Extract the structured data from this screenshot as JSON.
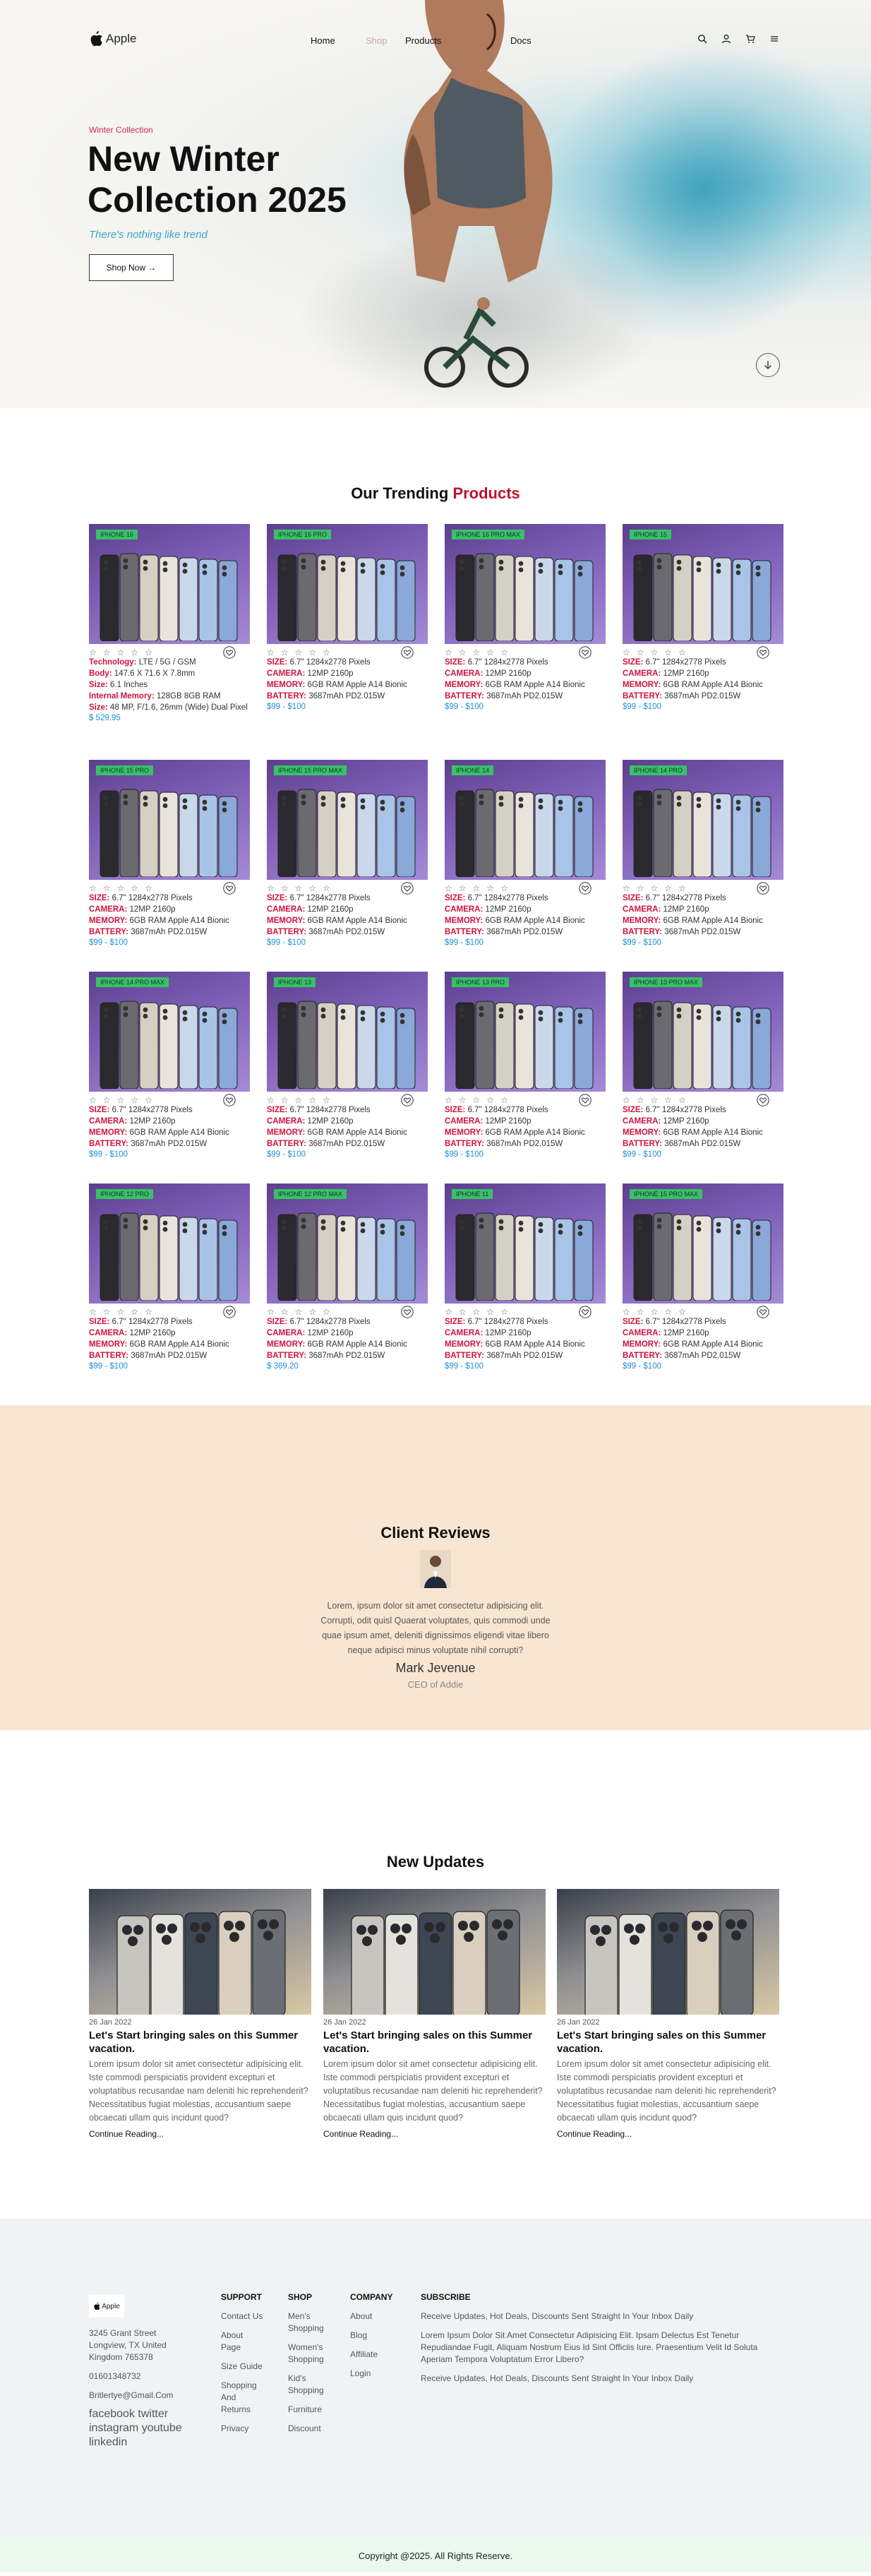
{
  "nav": {
    "brand": "Apple",
    "links": [
      "Home",
      "Shop",
      "Products",
      "Docs"
    ]
  },
  "hero": {
    "subtitle": "Winter Collection",
    "title_line1": "New Winter",
    "title_line2": "Collection 2025",
    "tagline": "There's nothing like trend",
    "button": "Shop Now →"
  },
  "trending": {
    "title_plain": "Our Trending",
    "title_accent": "Products",
    "spec_labels": {
      "size": "SIZE:",
      "camera": "CAMERA:",
      "memory": "MEMORY:",
      "battery": "BATTERY:"
    },
    "spec_values": {
      "size": "6.7\" 1284x2778 Pixels",
      "camera": "12MP 2160p",
      "memory": "6GB RAM Apple A14 Bionic",
      "battery": "3687mAh PD2.015W"
    },
    "first_card": {
      "technology_label": "Technology:",
      "technology": "LTE / 5G / GSM",
      "body_label": "Body:",
      "body": "147.6 X 71.6 X 7.8mm",
      "size_label": "Size:",
      "size": "6.1 Inches",
      "memory_label": "Internal Memory:",
      "memory": "128GB 8GB RAM",
      "camsize_label": "Size:",
      "camsize": "48 MP, F/1.6, 26mm (Wide) Dual Pixel",
      "price": "$ 529.95"
    },
    "cards": [
      {
        "badge": "IPHONE 16",
        "price": "$ 529.95"
      },
      {
        "badge": "IPHONE 16 PRO",
        "price": "$99 - $100"
      },
      {
        "badge": "IPHONE 16 PRO MAX",
        "price": "$99 - $100"
      },
      {
        "badge": "IPHONE 15",
        "price": "$99 - $100"
      },
      {
        "badge": "IPHONE 15 PRO",
        "price": "$99 - $100"
      },
      {
        "badge": "IPHONE 15 PRO MAX",
        "price": "$99 - $100"
      },
      {
        "badge": "IPHONE 14",
        "price": "$99 - $100"
      },
      {
        "badge": "IPHONE 14 PRO",
        "price": "$99 - $100"
      },
      {
        "badge": "IPHONE 14 PRO MAX",
        "price": "$99 - $100"
      },
      {
        "badge": "IPHONE 13",
        "price": "$99 - $100"
      },
      {
        "badge": "IPHONE 13 PRO",
        "price": "$99 - $100"
      },
      {
        "badge": "IPHONE 13 PRO MAX",
        "price": "$99 - $100"
      },
      {
        "badge": "IPHONE 12 PRO",
        "price": "$99 - $100"
      },
      {
        "badge": "IPHONE 12 PRO MAX",
        "price": "$ 369.20"
      },
      {
        "badge": "IPHONE 11",
        "price": "$99 - $100"
      },
      {
        "badge": "IPHONE 15 PRO MAX",
        "price": "$99 - $100"
      }
    ]
  },
  "reviews": {
    "title": "Client Reviews",
    "text": "Lorem, ipsum dolor sit amet consectetur adipisicing elit. Corrupti, odit quisl Quaerat voluptates, quis commodi unde quae ipsum amet, deleniti dignissimos eligendi vitae libero neque adipisci minus voluptate nihil corrupti?",
    "name": "Mark Jevenue",
    "role": "CEO of Addie"
  },
  "updates": {
    "title": "New Updates",
    "posts": [
      {
        "date": "26 Jan 2022",
        "title": "Let's Start bringing sales on this Summer vacation.",
        "body": "Lorem ipsum dolor sit amet consectetur adipisicing elit. Iste commodi perspiciatis provident excepturi et voluptatibus recusandae nam deleniti hic reprehenderit? Necessitatibus fugiat molestias, accusantium saepe obcaecati ullam quis incidunt quod?",
        "more": "Continue Reading..."
      },
      {
        "date": "26 Jan 2022",
        "title": "Let's Start bringing sales on this Summer vacation.",
        "body": "Lorem ipsum dolor sit amet consectetur adipisicing elit. Iste commodi perspiciatis provident excepturi et voluptatibus recusandae nam deleniti hic reprehenderit? Necessitatibus fugiat molestias, accusantium saepe obcaecati ullam quis incidunt quod?",
        "more": "Continue Reading..."
      },
      {
        "date": "26 Jan 2022",
        "title": "Let's Start bringing sales on this Summer vacation.",
        "body": "Lorem ipsum dolor sit amet consectetur adipisicing elit. Iste commodi perspiciatis provident excepturi et voluptatibus recusandae nam deleniti hic reprehenderit? Necessitatibus fugiat molestias, accusantium saepe obcaecati ullam quis incidunt quod?",
        "more": "Continue Reading..."
      }
    ]
  },
  "footer": {
    "brand": "Apple",
    "address": "3245 Grant Street Longview, TX United Kingdom 765378",
    "phone": "01601348732",
    "email": "Britlertye@Gmail.Com",
    "social": "facebook twitter instagram youtube linkedin",
    "support": {
      "head": "SUPPORT",
      "items": [
        "Contact Us",
        "About Page",
        "Size Guide",
        "Shopping And Returns",
        "Privacy"
      ]
    },
    "shop": {
      "head": "SHOP",
      "items": [
        "Men's Shopping",
        "Women's Shopping",
        "Kid's Shopping",
        "Furniture",
        "Discount"
      ]
    },
    "company": {
      "head": "COMPANY",
      "items": [
        "About",
        "Blog",
        "Affiliate",
        "Login"
      ]
    },
    "subscribe": {
      "head": "SUBSCRIBE",
      "line1": "Receive Updates, Hot Deals, Discounts Sent Straight In Your Inbox Daily",
      "line2": "Lorem Ipsum Dolor Sit Amet Consectetur Adipisicing Elit. Ipsam Delectus Est Tenetur Repudiandae Fugit, Aliquam Nostrum Eius Id Sint Officiis Iure. Praesentium Velit Id Soluta Aperiam Tempora Voluptatum Error Libero?",
      "line3": "Receive Updates, Hot Deals, Discounts Sent Straight In Your Inbox Daily"
    },
    "copyright": "Copyright @2025. All Rights Reserve."
  }
}
